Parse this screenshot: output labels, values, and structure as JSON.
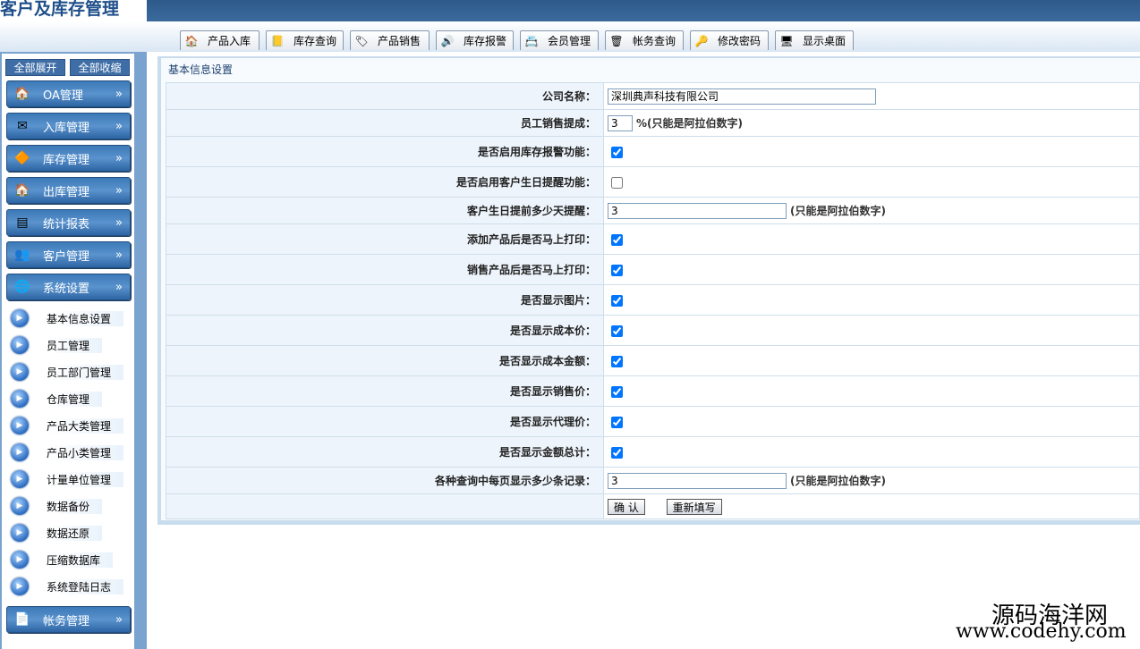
{
  "app": {
    "title": "客户及库存管理"
  },
  "tabs": [
    {
      "label": "产品入库",
      "icon": "house-icon",
      "glyph": "🏠"
    },
    {
      "label": "库存查询",
      "icon": "book-icon",
      "glyph": "📒"
    },
    {
      "label": "产品销售",
      "icon": "tag-icon",
      "glyph": "🏷"
    },
    {
      "label": "库存报警",
      "icon": "speaker-icon",
      "glyph": "🔊"
    },
    {
      "label": "会员管理",
      "icon": "member-card-icon",
      "glyph": "📇"
    },
    {
      "label": "帐务查询",
      "icon": "trash-icon",
      "glyph": "🗑"
    },
    {
      "label": "修改密码",
      "icon": "key-icon",
      "glyph": "🔑"
    },
    {
      "label": "显示桌面",
      "icon": "desktop-icon",
      "glyph": "🖥"
    }
  ],
  "sidebar": {
    "expand_all": "全部展开",
    "collapse_all": "全部收缩",
    "menus": [
      {
        "label": "OA管理",
        "icon": "home-icon",
        "glyph": "🏠",
        "arrow": "»"
      },
      {
        "label": "入库管理",
        "icon": "envelope-icon",
        "glyph": "✉",
        "arrow": "»"
      },
      {
        "label": "库存管理",
        "icon": "shapes-icon",
        "glyph": "🔶",
        "arrow": "»"
      },
      {
        "label": "出库管理",
        "icon": "home-icon",
        "glyph": "🏠",
        "arrow": "»"
      },
      {
        "label": "统计报表",
        "icon": "report-icon",
        "glyph": "▤",
        "arrow": "»"
      },
      {
        "label": "客户管理",
        "icon": "users-icon",
        "glyph": "👥",
        "arrow": "»"
      },
      {
        "label": "系统设置",
        "icon": "globe-icon",
        "glyph": "🌐",
        "arrow": "»"
      }
    ],
    "sub_items": [
      {
        "label": "基本信息设置"
      },
      {
        "label": "员工管理"
      },
      {
        "label": "员工部门管理"
      },
      {
        "label": "仓库管理"
      },
      {
        "label": "产品大类管理"
      },
      {
        "label": "产品小类管理"
      },
      {
        "label": "计量单位管理"
      },
      {
        "label": "数据备份"
      },
      {
        "label": "数据还原"
      },
      {
        "label": "压缩数据库"
      },
      {
        "label": "系统登陆日志"
      }
    ],
    "last_menu": {
      "label": "帐务管理",
      "icon": "ledger-icon",
      "glyph": "📄",
      "arrow": "»"
    }
  },
  "form": {
    "title": "基本信息设置",
    "company_label": "公司名称：",
    "company_value": "深圳典声科技有限公司",
    "commission_label": "员工销售提成：",
    "commission_value": "3",
    "commission_hint": "%(只能是阿拉伯数字)",
    "stock_alarm_label": "是否启用库存报警功能：",
    "stock_alarm_checked": true,
    "birthday_label": "是否启用客户生日提醒功能：",
    "birthday_checked": false,
    "birthday_days_label": "客户生日提前多少天提醒：",
    "birthday_days_value": "3",
    "birthday_days_hint": "(只能是阿拉伯数字)",
    "print_add_label": "添加产品后是否马上打印：",
    "print_add_checked": true,
    "print_sale_label": "销售产品后是否马上打印：",
    "print_sale_checked": true,
    "show_image_label": "是否显示图片：",
    "show_image_checked": true,
    "show_cost_label": "是否显示成本价：",
    "show_cost_checked": true,
    "show_cost_amount_label": "是否显示成本金额：",
    "show_cost_amount_checked": true,
    "show_sale_price_label": "是否显示销售价：",
    "show_sale_price_checked": true,
    "show_agent_price_label": "是否显示代理价：",
    "show_agent_price_checked": true,
    "show_total_label": "是否显示金额总计：",
    "show_total_checked": true,
    "records_label": "各种查询中每页显示多少条记录：",
    "records_value": "3",
    "records_hint": "(只能是阿拉伯数字)",
    "confirm_label": "确 认",
    "reset_label": "重新填写"
  },
  "watermark": {
    "line1": "源码海洋网",
    "line2": "www.codehy.com"
  }
}
